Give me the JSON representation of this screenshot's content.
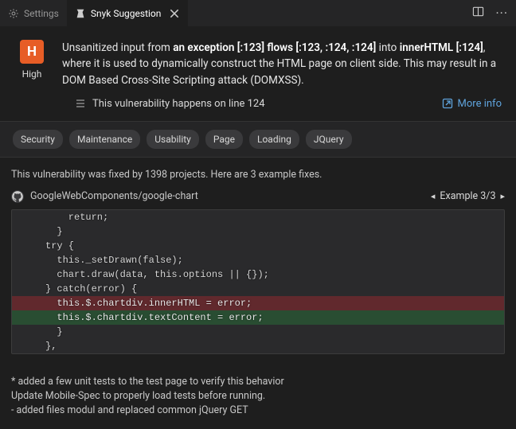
{
  "tabs": {
    "settings": "Settings",
    "snyk": "Snyk Suggestion"
  },
  "severity": {
    "letter": "H",
    "label": "High"
  },
  "description": {
    "t0": "Unsanitized input from ",
    "b1": "an exception [:123]",
    "t2": " ",
    "b3": "flows [:123, :124, :124]",
    "t4": " into ",
    "b5": "innerHTML [:124]",
    "t6": ", where it is used to dynamically construct the HTML page on client side. This may result in a DOM Based Cross-Site Scripting attack (DOMXSS)."
  },
  "infobar": {
    "line_text": "This vulnerability happens on line 124",
    "more_info": "More info"
  },
  "tags": [
    "Security",
    "Maintenance",
    "Usability",
    "Page",
    "Loading",
    "JQuery"
  ],
  "fixes": {
    "header": "This vulnerability was fixed by 1398 projects. Here are 3 example fixes.",
    "repo": "GoogleWebComponents/google-chart",
    "example_label": "Example 3/3",
    "code": {
      "l0": "    return;",
      "l1": "  }",
      "l2": "try {",
      "l3": "  this._setDrawn(false);",
      "l4": "  chart.draw(data, this.options || {});",
      "l5": "} catch(error) {",
      "l6": "  this.$.chartdiv.innerHTML = error;",
      "l7": "  this.$.chartdiv.textContent = error;",
      "l8": "  }",
      "l9": "},"
    }
  },
  "notes": {
    "n0": "* added a few unit tests to the test page to verify this behavior",
    "n1": "Update Mobile-Spec to properly load tests before running.",
    "n2": "- added files modul and replaced common jQuery GET"
  }
}
